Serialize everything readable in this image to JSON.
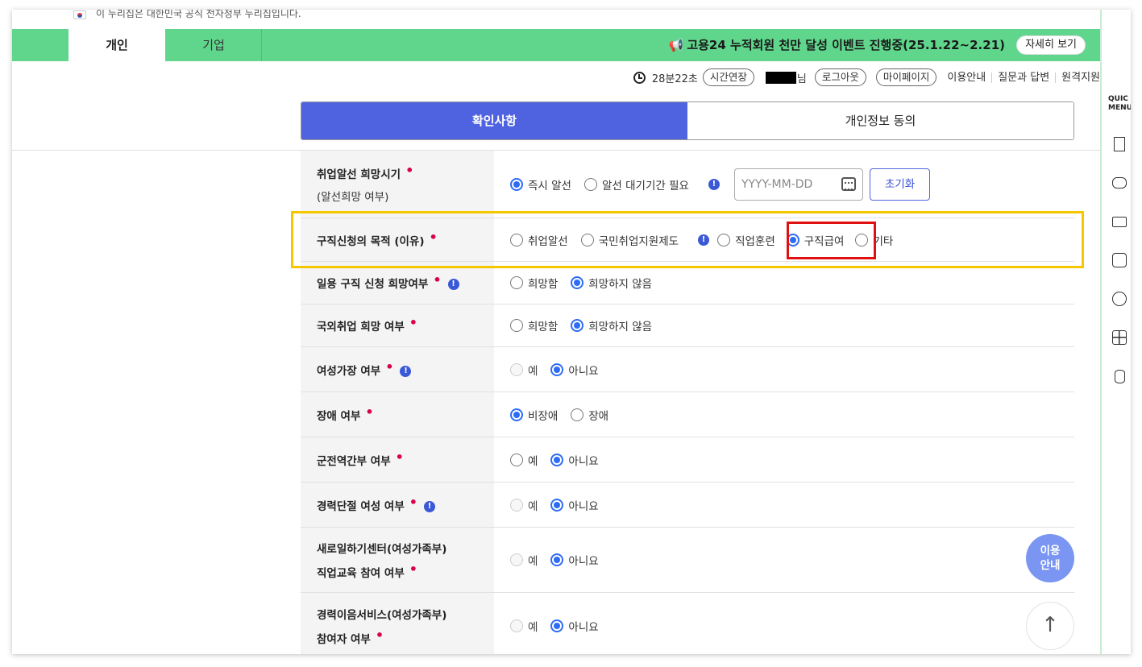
{
  "gov_banner": {
    "text": "이 누리집은 대한민국 공식 전자정부 누리집입니다."
  },
  "tabs": [
    {
      "label": "개인",
      "active": true
    },
    {
      "label": "기업",
      "active": false
    }
  ],
  "event": {
    "icon": "megaphone-icon",
    "text": "고용24 누적회원 천만 달성 이벤트 진행중(25.1.22~2.21)",
    "detail_label": "자세히 보기"
  },
  "utility": {
    "timer": "28분22초",
    "extend_label": "시간연장",
    "user_suffix": "님",
    "logout_label": "로그아웃",
    "mypage_label": "마이페이지",
    "links": [
      "이용안내",
      "질문과 답변",
      "원격지원"
    ]
  },
  "steps": [
    {
      "label": "확인사항",
      "active": true
    },
    {
      "label": "개인정보 동의",
      "active": false
    }
  ],
  "form": {
    "rows": [
      {
        "label": "취업알선 희망시기",
        "sublabel": "(알선희망 여부)",
        "options": [
          "즉시 알선",
          "알선 대기기간 필요"
        ],
        "selected": 0,
        "date_placeholder": "YYYY-MM-DD",
        "reset_label": "초기화"
      },
      {
        "label": "구직신청의 목적 (이유)",
        "options": [
          "취업알선",
          "국민취업지원제도",
          "직업훈련",
          "구직급여",
          "기타"
        ],
        "selected": 3
      },
      {
        "label": "일용 구직 신청 희망여부",
        "options": [
          "희망함",
          "희망하지 않음"
        ],
        "selected": 1
      },
      {
        "label": "국외취업 희망 여부",
        "options": [
          "희망함",
          "희망하지 않음"
        ],
        "selected": 1
      },
      {
        "label": "여성가장 여부",
        "options": [
          "예",
          "아니요"
        ],
        "selected": 1
      },
      {
        "label": "장애 여부",
        "options": [
          "비장애",
          "장애"
        ],
        "selected": 0
      },
      {
        "label": "군전역간부 여부",
        "options": [
          "예",
          "아니요"
        ],
        "selected": 1
      },
      {
        "label": "경력단절 여성 여부",
        "options": [
          "예",
          "아니요"
        ],
        "selected": 1
      },
      {
        "label": "새로일하기센터(여성가족부)",
        "sublabel": "직업교육 참여 여부",
        "options": [
          "예",
          "아니요"
        ],
        "selected": 1
      },
      {
        "label": "경력이음서비스(여성가족부)",
        "sublabel": "참여자 여부",
        "options": [
          "예",
          "아니요"
        ],
        "selected": 1
      }
    ]
  },
  "quick_menu": {
    "label_line1": "QUIC",
    "label_line2": "MENU",
    "icons": [
      "building-icon",
      "chat-icon",
      "monitor-icon",
      "checklist-icon",
      "smile-icon",
      "calculator-icon",
      "database-icon"
    ]
  },
  "floating": {
    "guide_line1": "이용",
    "guide_line2": "안내",
    "top_arrow": "↑"
  },
  "colors": {
    "green": "#5fd68c",
    "primary": "#4f63e0",
    "highlight_yellow": "#f6c700",
    "highlight_red": "#e01010"
  }
}
